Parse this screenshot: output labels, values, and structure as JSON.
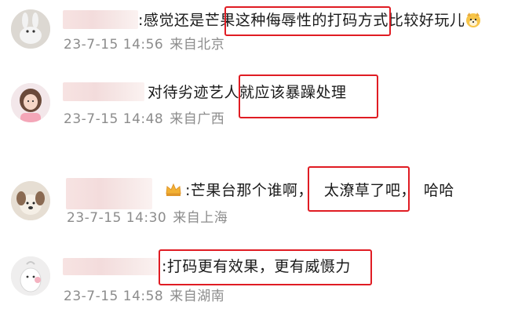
{
  "comments": [
    {
      "text": ":感觉还是芒果这种侮辱性的打码方式比较好玩儿",
      "emoji": "dog-face-emoji",
      "time": "23-7-15 14:56",
      "location": "来自北京"
    },
    {
      "text": "对待劣迹艺人就应该暴躁处理",
      "time": "23-7-15 14:48",
      "location": "来自广西"
    },
    {
      "text_a": ":芒果台那个谁啊，",
      "text_b": "太潦草了吧，",
      "text_c": "哈哈",
      "badge": "crown-badge-icon",
      "time": "23-7-15 14:30",
      "location": "来自上海"
    },
    {
      "text": ":打码更有效果，更有威慑力",
      "time": "23-7-15 14:58",
      "location": "来自湖南"
    }
  ],
  "colors": {
    "highlight_box": "#e01c23",
    "meta_text": "#8c8c8c",
    "body_text": "#1a1a1a"
  }
}
